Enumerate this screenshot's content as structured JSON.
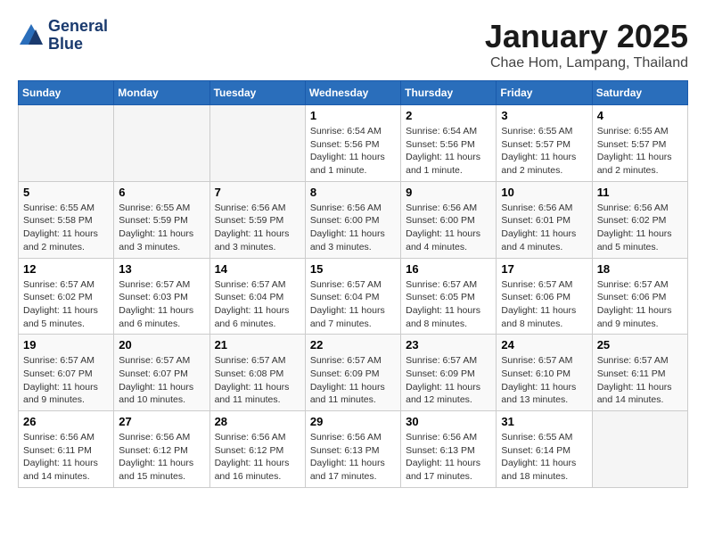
{
  "header": {
    "logo_line1": "General",
    "logo_line2": "Blue",
    "month_title": "January 2025",
    "location": "Chae Hom, Lampang, Thailand"
  },
  "weekdays": [
    "Sunday",
    "Monday",
    "Tuesday",
    "Wednesday",
    "Thursday",
    "Friday",
    "Saturday"
  ],
  "weeks": [
    [
      {
        "day": "",
        "info": ""
      },
      {
        "day": "",
        "info": ""
      },
      {
        "day": "",
        "info": ""
      },
      {
        "day": "1",
        "info": "Sunrise: 6:54 AM\nSunset: 5:56 PM\nDaylight: 11 hours\nand 1 minute."
      },
      {
        "day": "2",
        "info": "Sunrise: 6:54 AM\nSunset: 5:56 PM\nDaylight: 11 hours\nand 1 minute."
      },
      {
        "day": "3",
        "info": "Sunrise: 6:55 AM\nSunset: 5:57 PM\nDaylight: 11 hours\nand 2 minutes."
      },
      {
        "day": "4",
        "info": "Sunrise: 6:55 AM\nSunset: 5:57 PM\nDaylight: 11 hours\nand 2 minutes."
      }
    ],
    [
      {
        "day": "5",
        "info": "Sunrise: 6:55 AM\nSunset: 5:58 PM\nDaylight: 11 hours\nand 2 minutes."
      },
      {
        "day": "6",
        "info": "Sunrise: 6:55 AM\nSunset: 5:59 PM\nDaylight: 11 hours\nand 3 minutes."
      },
      {
        "day": "7",
        "info": "Sunrise: 6:56 AM\nSunset: 5:59 PM\nDaylight: 11 hours\nand 3 minutes."
      },
      {
        "day": "8",
        "info": "Sunrise: 6:56 AM\nSunset: 6:00 PM\nDaylight: 11 hours\nand 3 minutes."
      },
      {
        "day": "9",
        "info": "Sunrise: 6:56 AM\nSunset: 6:00 PM\nDaylight: 11 hours\nand 4 minutes."
      },
      {
        "day": "10",
        "info": "Sunrise: 6:56 AM\nSunset: 6:01 PM\nDaylight: 11 hours\nand 4 minutes."
      },
      {
        "day": "11",
        "info": "Sunrise: 6:56 AM\nSunset: 6:02 PM\nDaylight: 11 hours\nand 5 minutes."
      }
    ],
    [
      {
        "day": "12",
        "info": "Sunrise: 6:57 AM\nSunset: 6:02 PM\nDaylight: 11 hours\nand 5 minutes."
      },
      {
        "day": "13",
        "info": "Sunrise: 6:57 AM\nSunset: 6:03 PM\nDaylight: 11 hours\nand 6 minutes."
      },
      {
        "day": "14",
        "info": "Sunrise: 6:57 AM\nSunset: 6:04 PM\nDaylight: 11 hours\nand 6 minutes."
      },
      {
        "day": "15",
        "info": "Sunrise: 6:57 AM\nSunset: 6:04 PM\nDaylight: 11 hours\nand 7 minutes."
      },
      {
        "day": "16",
        "info": "Sunrise: 6:57 AM\nSunset: 6:05 PM\nDaylight: 11 hours\nand 8 minutes."
      },
      {
        "day": "17",
        "info": "Sunrise: 6:57 AM\nSunset: 6:06 PM\nDaylight: 11 hours\nand 8 minutes."
      },
      {
        "day": "18",
        "info": "Sunrise: 6:57 AM\nSunset: 6:06 PM\nDaylight: 11 hours\nand 9 minutes."
      }
    ],
    [
      {
        "day": "19",
        "info": "Sunrise: 6:57 AM\nSunset: 6:07 PM\nDaylight: 11 hours\nand 9 minutes."
      },
      {
        "day": "20",
        "info": "Sunrise: 6:57 AM\nSunset: 6:07 PM\nDaylight: 11 hours\nand 10 minutes."
      },
      {
        "day": "21",
        "info": "Sunrise: 6:57 AM\nSunset: 6:08 PM\nDaylight: 11 hours\nand 11 minutes."
      },
      {
        "day": "22",
        "info": "Sunrise: 6:57 AM\nSunset: 6:09 PM\nDaylight: 11 hours\nand 11 minutes."
      },
      {
        "day": "23",
        "info": "Sunrise: 6:57 AM\nSunset: 6:09 PM\nDaylight: 11 hours\nand 12 minutes."
      },
      {
        "day": "24",
        "info": "Sunrise: 6:57 AM\nSunset: 6:10 PM\nDaylight: 11 hours\nand 13 minutes."
      },
      {
        "day": "25",
        "info": "Sunrise: 6:57 AM\nSunset: 6:11 PM\nDaylight: 11 hours\nand 14 minutes."
      }
    ],
    [
      {
        "day": "26",
        "info": "Sunrise: 6:56 AM\nSunset: 6:11 PM\nDaylight: 11 hours\nand 14 minutes."
      },
      {
        "day": "27",
        "info": "Sunrise: 6:56 AM\nSunset: 6:12 PM\nDaylight: 11 hours\nand 15 minutes."
      },
      {
        "day": "28",
        "info": "Sunrise: 6:56 AM\nSunset: 6:12 PM\nDaylight: 11 hours\nand 16 minutes."
      },
      {
        "day": "29",
        "info": "Sunrise: 6:56 AM\nSunset: 6:13 PM\nDaylight: 11 hours\nand 17 minutes."
      },
      {
        "day": "30",
        "info": "Sunrise: 6:56 AM\nSunset: 6:13 PM\nDaylight: 11 hours\nand 17 minutes."
      },
      {
        "day": "31",
        "info": "Sunrise: 6:55 AM\nSunset: 6:14 PM\nDaylight: 11 hours\nand 18 minutes."
      },
      {
        "day": "",
        "info": ""
      }
    ]
  ]
}
